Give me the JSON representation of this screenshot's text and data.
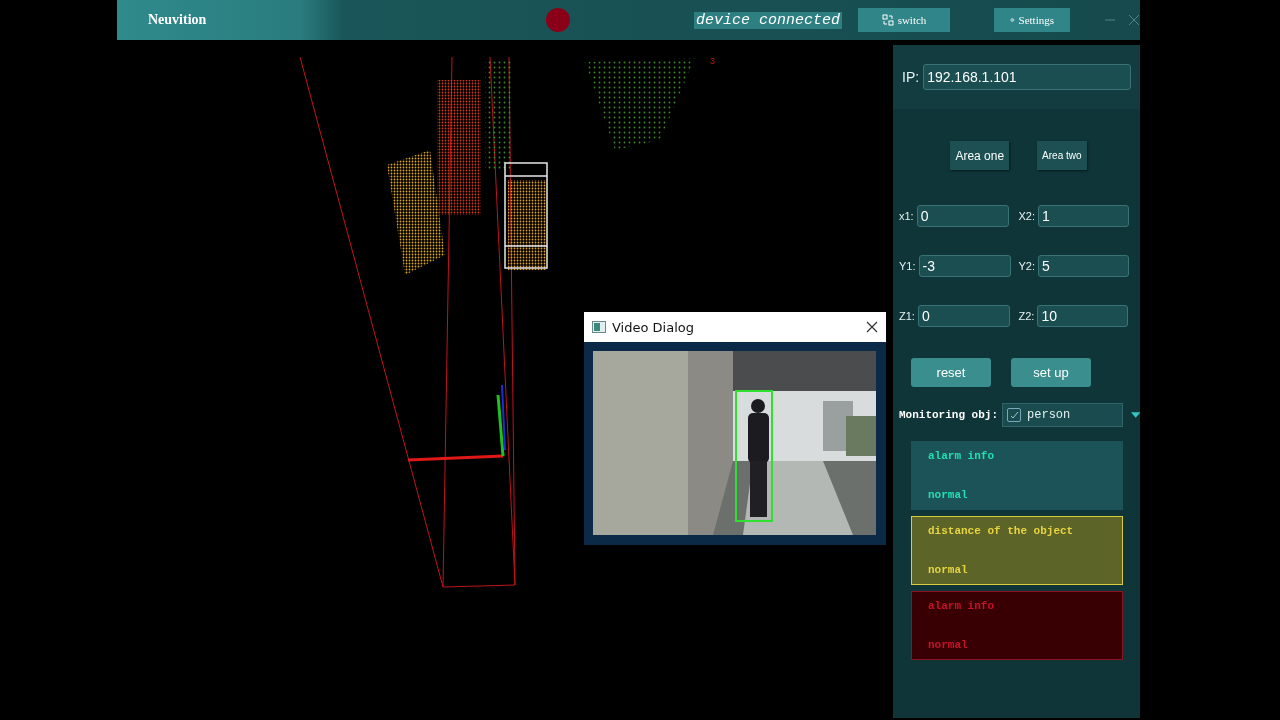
{
  "window": {
    "title": "Neuvition",
    "status": "device connected",
    "buttons": [
      {
        "label": "switch",
        "kind": "switch"
      },
      {
        "label": "Settings",
        "kind": "settings"
      }
    ]
  },
  "viewer": {
    "marker_label": "3"
  },
  "video_dialog": {
    "title": "Video Dialog"
  },
  "panel": {
    "ip": {
      "label": "IP:",
      "value": "192.168.1.101"
    },
    "areas": [
      "Area one",
      "Area two"
    ],
    "fields": [
      {
        "label": "x1:",
        "value": "0"
      },
      {
        "label": "X2:",
        "value": "1"
      },
      {
        "label": "Y1:",
        "value": "-3"
      },
      {
        "label": "Y2:",
        "value": "5"
      },
      {
        "label": "Z1:",
        "value": "0"
      },
      {
        "label": "Z2:",
        "value": "10"
      }
    ],
    "actions": [
      "reset",
      "set up"
    ],
    "monitoring": {
      "label": "Monitoring obj:",
      "checked": true,
      "value": "person"
    },
    "alerts": [
      {
        "kind": "info",
        "title": "alarm info",
        "status": "normal"
      },
      {
        "kind": "warning",
        "title": "distance of the object",
        "status": "normal"
      },
      {
        "kind": "danger",
        "title": "alarm info",
        "status": "normal"
      }
    ]
  }
}
